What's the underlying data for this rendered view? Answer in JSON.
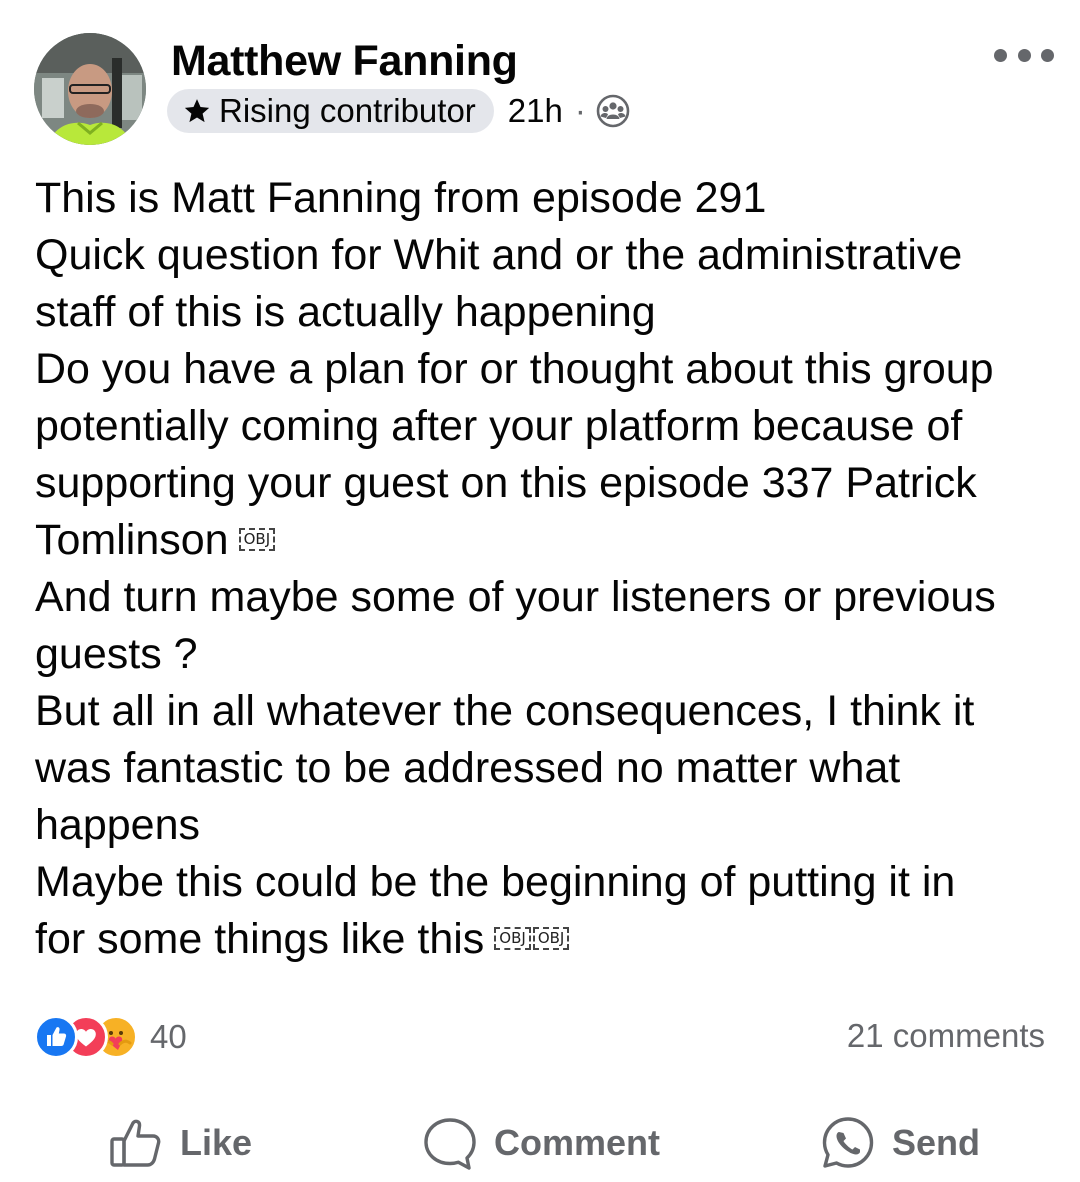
{
  "post": {
    "author": {
      "name": "Matthew Fanning",
      "avatar_icon": "user-avatar-photo"
    },
    "badge": {
      "label": "Rising contributor",
      "icon": "star-icon"
    },
    "time": "21h",
    "separator": "·",
    "audience_icon": "group-icon",
    "more_icon": "more-options-icon",
    "body_lines": [
      "This is Matt Fanning from episode 291",
      "Quick question for Whit and or the administrative",
      "staff of this is actually happening",
      "Do you have a plan for or thought about this group",
      "potentially coming after your platform because of",
      "supporting your guest on this episode 337 Patrick",
      "Tomlinson",
      "And turn maybe some of your listeners or previous",
      "guests ?",
      "But all in all whatever the consequences, I think it",
      "was fantastic to be addressed no matter what",
      "happens",
      "Maybe this could be the beginning of putting it in",
      "for some things like this"
    ],
    "obj_placeholder": "OBJ"
  },
  "engagement": {
    "reaction_icons": [
      "like-reaction-icon",
      "love-reaction-icon",
      "care-reaction-icon"
    ],
    "reaction_count": "40",
    "comments": "21 comments"
  },
  "actions": {
    "like": "Like",
    "comment": "Comment",
    "send": "Send"
  },
  "colors": {
    "text": "#050505",
    "secondary": "#65676b",
    "badge_bg": "#e4e6eb",
    "like_blue": "#1877f2",
    "love_red": "#f33e58",
    "care_yellow": "#f7b125"
  }
}
